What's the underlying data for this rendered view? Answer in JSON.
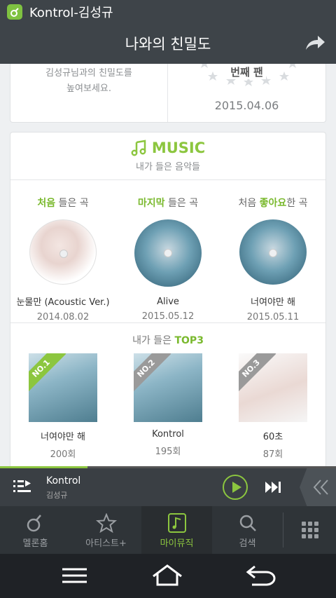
{
  "status": {
    "app_title": "Kontrol-김성규"
  },
  "header": {
    "title": "나와의 친밀도"
  },
  "intimacy": {
    "desc_line1": "김성규님과의 친밀도를",
    "desc_line2": "높여보세요.",
    "fan_rank": "번째 팬",
    "fan_date": "2015.04.06"
  },
  "music": {
    "title": "MUSIC",
    "subtitle": "내가 들은 음악들",
    "columns": [
      {
        "head_hl": "처음",
        "head_rest": " 들은 곡",
        "song": "눈물만 (Acoustic Ver.)",
        "date": "2014.08.02",
        "art": "white"
      },
      {
        "head_hl": "마지막",
        "head_rest": " 들은 곡",
        "song": "Alive",
        "date": "2015.05.12",
        "art": "blue"
      },
      {
        "head_pre": "처음 ",
        "head_hl": "좋아요",
        "head_rest": "한 곡",
        "song": "너여야만 해",
        "date": "2015.05.11",
        "art": "blue"
      }
    ],
    "top3_pre": "내가 들은 ",
    "top3_hl": "TOP3",
    "top3": [
      {
        "rank": "NO.1",
        "song": "너여야만 해",
        "count": "200회"
      },
      {
        "rank": "NO.2",
        "song": "Kontrol",
        "count": "195회"
      },
      {
        "rank": "NO.3",
        "song": "60초",
        "count": "87회"
      }
    ]
  },
  "player": {
    "title": "Kontrol",
    "artist": "김성규",
    "progress": 0.26
  },
  "tabs": [
    {
      "label": "멜론홈",
      "icon": "melon-icon"
    },
    {
      "label": "아티스트+",
      "icon": "star-icon"
    },
    {
      "label": "마이뮤직",
      "icon": "music-note-icon"
    },
    {
      "label": "검색",
      "icon": "search-icon"
    }
  ],
  "colors": {
    "accent": "#8cc63f",
    "bar": "#3e4449"
  }
}
